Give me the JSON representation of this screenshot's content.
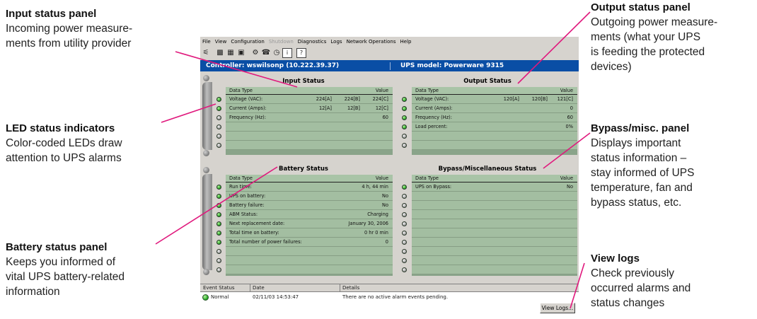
{
  "callouts": {
    "input": {
      "title": "Input status panel",
      "lines": [
        "Incoming power measure-",
        "ments from utility provider"
      ]
    },
    "led": {
      "title": "LED status indicators",
      "lines": [
        "Color-coded LEDs draw",
        "attention to UPS alarms"
      ]
    },
    "battery": {
      "title": "Battery status panel",
      "lines": [
        "Keeps you informed of",
        "vital UPS battery-related",
        "information"
      ]
    },
    "output": {
      "title": "Output status panel",
      "lines": [
        "Outgoing power measure-",
        "ments (what your UPS",
        "is feeding the protected",
        "devices)"
      ]
    },
    "bypass": {
      "title": "Bypass/misc. panel",
      "lines": [
        "Displays important",
        "status information –",
        "stay informed of UPS",
        "temperature, fan and",
        "bypass status, etc."
      ]
    },
    "logs": {
      "title": "View logs",
      "lines": [
        "Check previously",
        "occurred alarms and",
        "status changes"
      ]
    }
  },
  "menu": [
    {
      "label": "File",
      "enabled": true
    },
    {
      "label": "View",
      "enabled": true
    },
    {
      "label": "Configuration",
      "enabled": true
    },
    {
      "label": "Shutdown",
      "enabled": false
    },
    {
      "label": "Diagnostics",
      "enabled": true
    },
    {
      "label": "Logs",
      "enabled": true
    },
    {
      "label": "Network Operations",
      "enabled": true
    },
    {
      "label": "Help",
      "enabled": true
    }
  ],
  "toolbar_icons": [
    "network-icon",
    "monitor-icon",
    "table-icon",
    "grid-icon",
    "gear-icon",
    "bell-icon",
    "clock-icon",
    "help-icon"
  ],
  "infobar": {
    "controller": "Controller:  wswilsonp (10.222.39.37)",
    "model": "UPS model:  Powerware 9315"
  },
  "panels": {
    "input": {
      "title": "Input Status",
      "header": [
        "Data Type",
        "Value"
      ],
      "rows": [
        {
          "led": "on",
          "label": "Voltage (VAC):",
          "vals": [
            "224[A]",
            "224[B]",
            "224[C]"
          ]
        },
        {
          "led": "on",
          "label": "Current (Amps):",
          "vals": [
            "12[A]",
            "12[B]",
            "12[C]"
          ]
        },
        {
          "led": "off",
          "label": "Frequency (Hz):",
          "vals": [
            "",
            "",
            "60"
          ]
        },
        {
          "led": "off",
          "label": "",
          "vals": [
            "",
            "",
            ""
          ]
        },
        {
          "led": "off",
          "label": "",
          "vals": [
            "",
            "",
            ""
          ]
        },
        {
          "led": "off",
          "label": "",
          "vals": [
            "",
            "",
            ""
          ]
        }
      ]
    },
    "output": {
      "title": "Output Status",
      "header": [
        "Data Type",
        "Value"
      ],
      "rows": [
        {
          "led": "on",
          "label": "Voltage (VAC):",
          "vals": [
            "120[A]",
            "120[B]",
            "121[C]"
          ]
        },
        {
          "led": "on",
          "label": "Current (Amps):",
          "vals": [
            "",
            "",
            "0"
          ]
        },
        {
          "led": "on",
          "label": "Frequency (Hz):",
          "vals": [
            "",
            "",
            "60"
          ]
        },
        {
          "led": "on",
          "label": "Load percent:",
          "vals": [
            "",
            "",
            "0%"
          ]
        },
        {
          "led": "off",
          "label": "",
          "vals": [
            "",
            "",
            ""
          ]
        },
        {
          "led": "off",
          "label": "",
          "vals": [
            "",
            "",
            ""
          ]
        }
      ]
    },
    "battery": {
      "title": "Battery Status",
      "header": [
        "Data Type",
        "Value"
      ],
      "rows": [
        {
          "led": "on",
          "label": "Run time:",
          "vals": [
            "",
            "",
            "4 h, 44 min"
          ]
        },
        {
          "led": "on",
          "label": "UPS on battery:",
          "vals": [
            "",
            "",
            "No"
          ]
        },
        {
          "led": "on",
          "label": "Battery failure:",
          "vals": [
            "",
            "",
            "No"
          ]
        },
        {
          "led": "on",
          "label": "ABM Status:",
          "vals": [
            "",
            "",
            "Charging"
          ]
        },
        {
          "led": "on",
          "label": "Next replacement date:",
          "vals": [
            "",
            "",
            "January 30, 2006"
          ]
        },
        {
          "led": "on",
          "label": "Total time on battery:",
          "vals": [
            "",
            "",
            "0 hr 0 min"
          ]
        },
        {
          "led": "on",
          "label": "Total number of power failures:",
          "vals": [
            "",
            "",
            "0"
          ]
        },
        {
          "led": "off",
          "label": "",
          "vals": [
            "",
            "",
            ""
          ]
        },
        {
          "led": "off",
          "label": "",
          "vals": [
            "",
            "",
            ""
          ]
        },
        {
          "led": "off",
          "label": "",
          "vals": [
            "",
            "",
            ""
          ]
        }
      ]
    },
    "bypass": {
      "title": "Bypass/Miscellaneous Status",
      "header": [
        "Data Type",
        "Value"
      ],
      "rows": [
        {
          "led": "on",
          "label": "UPS on Bypass:",
          "vals": [
            "",
            "",
            "No"
          ]
        },
        {
          "led": "off",
          "label": "",
          "vals": [
            "",
            "",
            ""
          ]
        },
        {
          "led": "off",
          "label": "",
          "vals": [
            "",
            "",
            ""
          ]
        },
        {
          "led": "off",
          "label": "",
          "vals": [
            "",
            "",
            ""
          ]
        },
        {
          "led": "off",
          "label": "",
          "vals": [
            "",
            "",
            ""
          ]
        },
        {
          "led": "off",
          "label": "",
          "vals": [
            "",
            "",
            ""
          ]
        },
        {
          "led": "off",
          "label": "",
          "vals": [
            "",
            "",
            ""
          ]
        },
        {
          "led": "off",
          "label": "",
          "vals": [
            "",
            "",
            ""
          ]
        },
        {
          "led": "off",
          "label": "",
          "vals": [
            "",
            "",
            ""
          ]
        },
        {
          "led": "off",
          "label": "",
          "vals": [
            "",
            "",
            ""
          ]
        }
      ]
    }
  },
  "eventlog": {
    "columns": [
      "Event Status",
      "Date",
      "Details"
    ],
    "rows": [
      {
        "status": "Normal",
        "date": "02/11/03  14:53:47",
        "details": "There are no active alarm events pending."
      }
    ],
    "view_logs_label": "View Logs..."
  },
  "colors": {
    "infobar": "#0a4ea5",
    "led_on": "#1fa11d",
    "panel_row": "#a3bea1",
    "callout_line": "#e0197d"
  }
}
